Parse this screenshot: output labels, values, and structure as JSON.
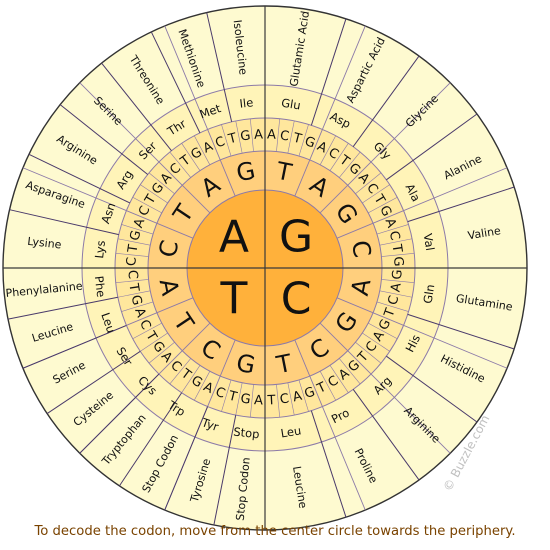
{
  "center_bases": [
    "G",
    "C",
    "T",
    "A"
  ],
  "ring2": [
    [
      "T",
      "A",
      "G",
      "C"
    ],
    [
      "A",
      "G",
      "C",
      "T"
    ],
    [
      "G",
      "C",
      "T",
      "A"
    ],
    [
      "C",
      "T",
      "A",
      "G"
    ]
  ],
  "ring3": [
    [
      "A",
      "C",
      "T",
      "G",
      "A",
      "C",
      "T",
      "G",
      "A",
      "C",
      "T",
      "G",
      "A",
      "C",
      "T",
      "G"
    ],
    [
      "G",
      "A",
      "C",
      "T",
      "G",
      "A",
      "C",
      "T",
      "G",
      "A",
      "C",
      "T",
      "G",
      "A",
      "C",
      "T"
    ],
    [
      "A",
      "G",
      "T",
      "C",
      "A",
      "G",
      "T",
      "C",
      "A",
      "G",
      "T",
      "C",
      "A",
      "G",
      "T",
      "C"
    ],
    [
      "C",
      "T",
      "G",
      "A",
      "C",
      "T",
      "G",
      "A",
      "C",
      "T",
      "G",
      "A",
      "C",
      "T",
      "G",
      "A"
    ]
  ],
  "amino_abbrev": [
    [
      "Glu",
      "Asp",
      "Gly",
      "Ala",
      "Val"
    ],
    [
      "Gln",
      "His",
      "Arg",
      "Pro",
      "Leu"
    ],
    [
      "Stop",
      "Tyr",
      "Trp",
      "Cys",
      "Ser",
      "Leu",
      "Phe"
    ],
    [
      "Lys",
      "Asn",
      "Arg",
      "Ser",
      "Thr",
      "Met",
      "Ile"
    ]
  ],
  "amino_full": [
    [
      "Glutamic Acid",
      "Aspartic Acid",
      "Glycine",
      "Alanine",
      "Valine"
    ],
    [
      "Glutamine",
      "Histidine",
      "Arginine",
      "Proline",
      "Leucine"
    ],
    [
      "Stop Codon",
      "Tyrosine",
      "Stop Codon",
      "Tryptophan",
      "Cysteine",
      "Serine",
      "Leucine",
      "Phenylalanine"
    ],
    [
      "Lysine",
      "Asparagine",
      "Arginine",
      "Serine",
      "Threonine",
      "Methionine",
      "Isoleucine"
    ]
  ],
  "watermark": "© Buzzle.com",
  "caption": "To decode the codon, move from the center circle towards the periphery.",
  "colors": {
    "center": "#ffb13b",
    "ring2": "#ffcf7d",
    "ring3": "#ffe79d",
    "ring4": "#fff4b8",
    "ring5": "#fefad0",
    "outline": "#8c7aa8",
    "divider": "#3a3a3a",
    "caption": "#7a4300"
  }
}
